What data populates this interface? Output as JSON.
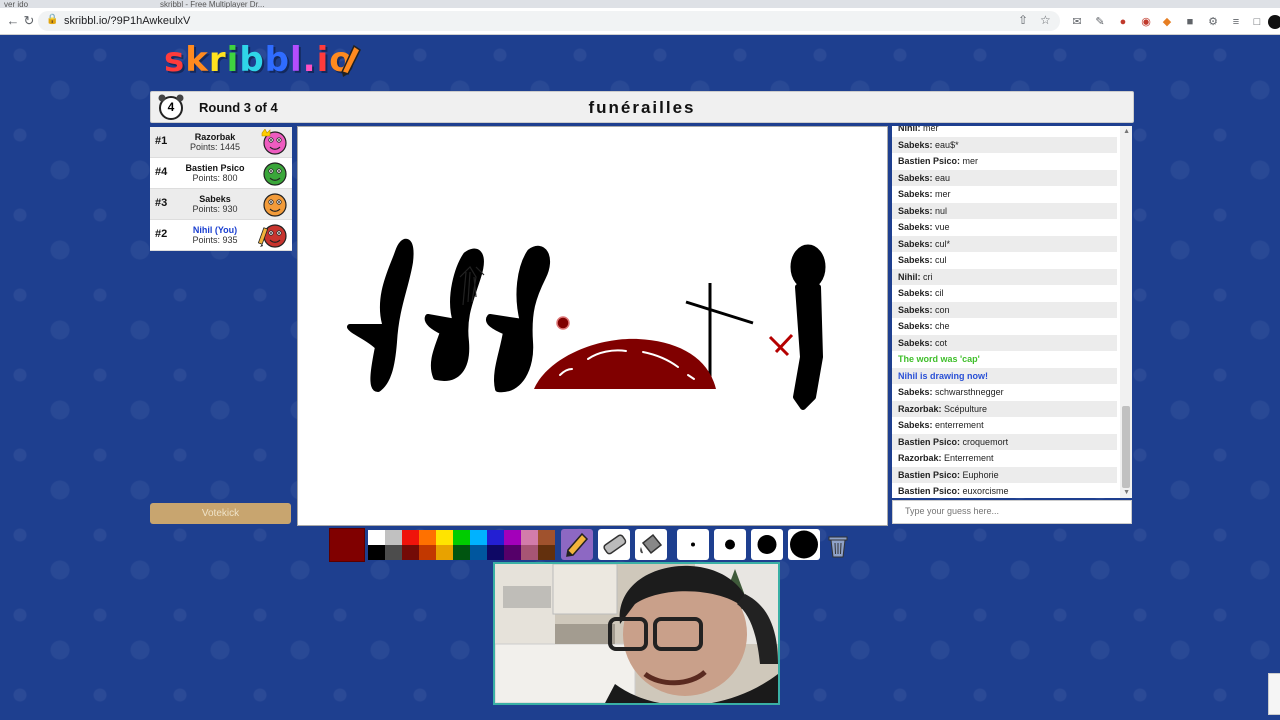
{
  "browser": {
    "tabs": [
      {
        "label": "ver ido"
      },
      {
        "label": "skribbl - Free Multiplayer Dr..."
      }
    ],
    "url": "skribbl.io/?9P1hAwkeulxV"
  },
  "logo": {
    "text": "skribbl.io",
    "letters": [
      "s",
      "k",
      "r",
      "i",
      "b",
      "b",
      "l",
      ".",
      "i",
      "o"
    ],
    "colors": [
      "#ff3b3b",
      "#ff8a1f",
      "#ffe21f",
      "#3fd43f",
      "#2fd5e8",
      "#2f6cff",
      "#b44dff",
      "#ff4fc3",
      "#ff3b3b",
      "#ff8a1f"
    ]
  },
  "header": {
    "round_number": "4",
    "round_text": "Round 3 of 4",
    "word": "funérailles"
  },
  "players": [
    {
      "rank": "#1",
      "name": "Razorbak",
      "points": "Points: 1445",
      "avatar_color": "#ee5cc0",
      "crown": true,
      "drawing": false,
      "you": false
    },
    {
      "rank": "#4",
      "name": "Bastien Psico",
      "points": "Points: 800",
      "avatar_color": "#3aa63a",
      "crown": false,
      "drawing": false,
      "you": false
    },
    {
      "rank": "#3",
      "name": "Sabeks",
      "points": "Points: 930",
      "avatar_color": "#f29b3a",
      "crown": false,
      "drawing": false,
      "you": false
    },
    {
      "rank": "#2",
      "name": "Nihil (You)",
      "points": "Points: 935",
      "avatar_color": "#c8342e",
      "crown": false,
      "drawing": true,
      "you": true
    }
  ],
  "votekick_label": "Votekick",
  "chat": [
    {
      "user": "Nihil:",
      "text": "mer",
      "type": "normal"
    },
    {
      "user": "Sabeks:",
      "text": "eau$*",
      "type": "normal"
    },
    {
      "user": "Bastien Psico:",
      "text": "mer",
      "type": "normal"
    },
    {
      "user": "Sabeks:",
      "text": "eau",
      "type": "normal"
    },
    {
      "user": "Sabeks:",
      "text": "mer",
      "type": "normal"
    },
    {
      "user": "Sabeks:",
      "text": "nul",
      "type": "normal"
    },
    {
      "user": "Sabeks:",
      "text": "vue",
      "type": "normal"
    },
    {
      "user": "Sabeks:",
      "text": "cul*",
      "type": "normal"
    },
    {
      "user": "Sabeks:",
      "text": "cul",
      "type": "normal"
    },
    {
      "user": "Nihil:",
      "text": "cri",
      "type": "normal"
    },
    {
      "user": "Sabeks:",
      "text": "cil",
      "type": "normal"
    },
    {
      "user": "Sabeks:",
      "text": "con",
      "type": "normal"
    },
    {
      "user": "Sabeks:",
      "text": "che",
      "type": "normal"
    },
    {
      "user": "Sabeks:",
      "text": "cot",
      "type": "normal"
    },
    {
      "user": "",
      "text": "The word was 'cap'",
      "type": "green"
    },
    {
      "user": "",
      "text": "Nihil is drawing now!",
      "type": "blue"
    },
    {
      "user": "Sabeks:",
      "text": "schwarsthnegger",
      "type": "normal"
    },
    {
      "user": "Razorbak:",
      "text": "Scépulture",
      "type": "normal"
    },
    {
      "user": "Sabeks:",
      "text": "enterrement",
      "type": "normal"
    },
    {
      "user": "Bastien Psico:",
      "text": "croquemort",
      "type": "normal"
    },
    {
      "user": "Razorbak:",
      "text": "Enterrement",
      "type": "normal"
    },
    {
      "user": "Bastien Psico:",
      "text": "Euphorie",
      "type": "normal"
    },
    {
      "user": "Bastien Psico:",
      "text": "euxorcisme",
      "type": "normal"
    }
  ],
  "guess_placeholder": "Type your guess here...",
  "current_color": "#800000",
  "palette_top": [
    "#ffffff",
    "#c1c1c1",
    "#ef130b",
    "#ff7100",
    "#ffe400",
    "#00cc00",
    "#00b2ff",
    "#231fd3",
    "#a300ba",
    "#d37caa",
    "#a0522d"
  ],
  "palette_bottom": [
    "#000000",
    "#4c4c4c",
    "#740b07",
    "#c23800",
    "#e8a200",
    "#005510",
    "#00569e",
    "#0e0865",
    "#550069",
    "#a75574",
    "#63300d"
  ],
  "tools": {
    "pen": "pencil-icon",
    "eraser": "eraser-icon",
    "fill": "fill-bucket-icon",
    "brush_sizes": [
      "brush-size-small",
      "brush-size-medium",
      "brush-size-large",
      "brush-size-xlarge"
    ],
    "clear": "trash-icon"
  }
}
